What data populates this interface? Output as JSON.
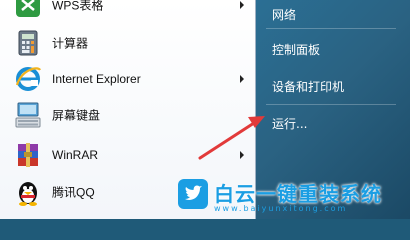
{
  "left_menu": {
    "items": [
      {
        "label": "WPS表格",
        "has_submenu": true,
        "icon": "wps-spreadsheet-icon"
      },
      {
        "label": "计算器",
        "has_submenu": false,
        "icon": "calculator-icon"
      },
      {
        "label": "Internet Explorer",
        "has_submenu": true,
        "icon": "internet-explorer-icon"
      },
      {
        "label": "屏幕键盘",
        "has_submenu": false,
        "icon": "on-screen-keyboard-icon"
      },
      {
        "label": "WinRAR",
        "has_submenu": true,
        "icon": "winrar-icon"
      },
      {
        "label": "腾讯QQ",
        "has_submenu": false,
        "icon": "qq-penguin-icon"
      }
    ]
  },
  "right_menu": {
    "items": [
      {
        "label": "网络"
      },
      {
        "label": "控制面板"
      },
      {
        "label": "设备和打印机"
      },
      {
        "label": "运行..."
      }
    ]
  },
  "watermark": {
    "title": "白云一键重装系统",
    "url": "www.baiyunxitong.com",
    "color": "#1b9ee3"
  },
  "annotation": {
    "arrow_color": "#e23a3a",
    "target": "运行..."
  }
}
